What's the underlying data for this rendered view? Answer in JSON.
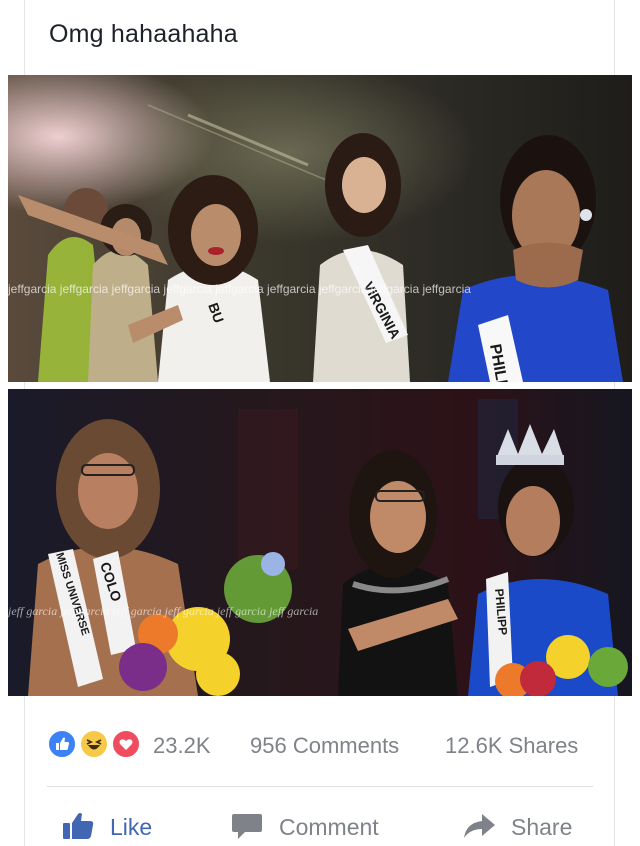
{
  "post": {
    "text": "Omg hahaahaha"
  },
  "photos": {
    "watermark": "jeffgarcia jeffgarcia jeffgarcia jeffgarcia jeffgarcia jeffgarcia jeffgarcia jeffgarcia jeffgarcia",
    "watermark_script": "jeff garcia  jeff garcia  jeff garcia  jeff garcia  jeff garcia  jeff garcia",
    "sash_labels": {
      "virginia": "VIRGINIA",
      "phili": "PHILI",
      "bu": "BU",
      "miss_universe": "MISS UNIVERSE",
      "colombia": "COLO",
      "philippines": "PHILIPP"
    }
  },
  "stats": {
    "reaction_icons": [
      "like-reaction-icon",
      "haha-reaction-icon",
      "love-reaction-icon"
    ],
    "reaction_count": "23.2K",
    "comments": "956 Comments",
    "shares": "12.6K Shares"
  },
  "actions": {
    "like": "Like",
    "comment": "Comment",
    "share": "Share"
  },
  "colors": {
    "facebook_blue": "#4267b2",
    "muted_text": "#7f8389",
    "like_reaction": "#3b82f6",
    "haha_reaction": "#f7c948",
    "love_reaction": "#ef4d5e"
  }
}
